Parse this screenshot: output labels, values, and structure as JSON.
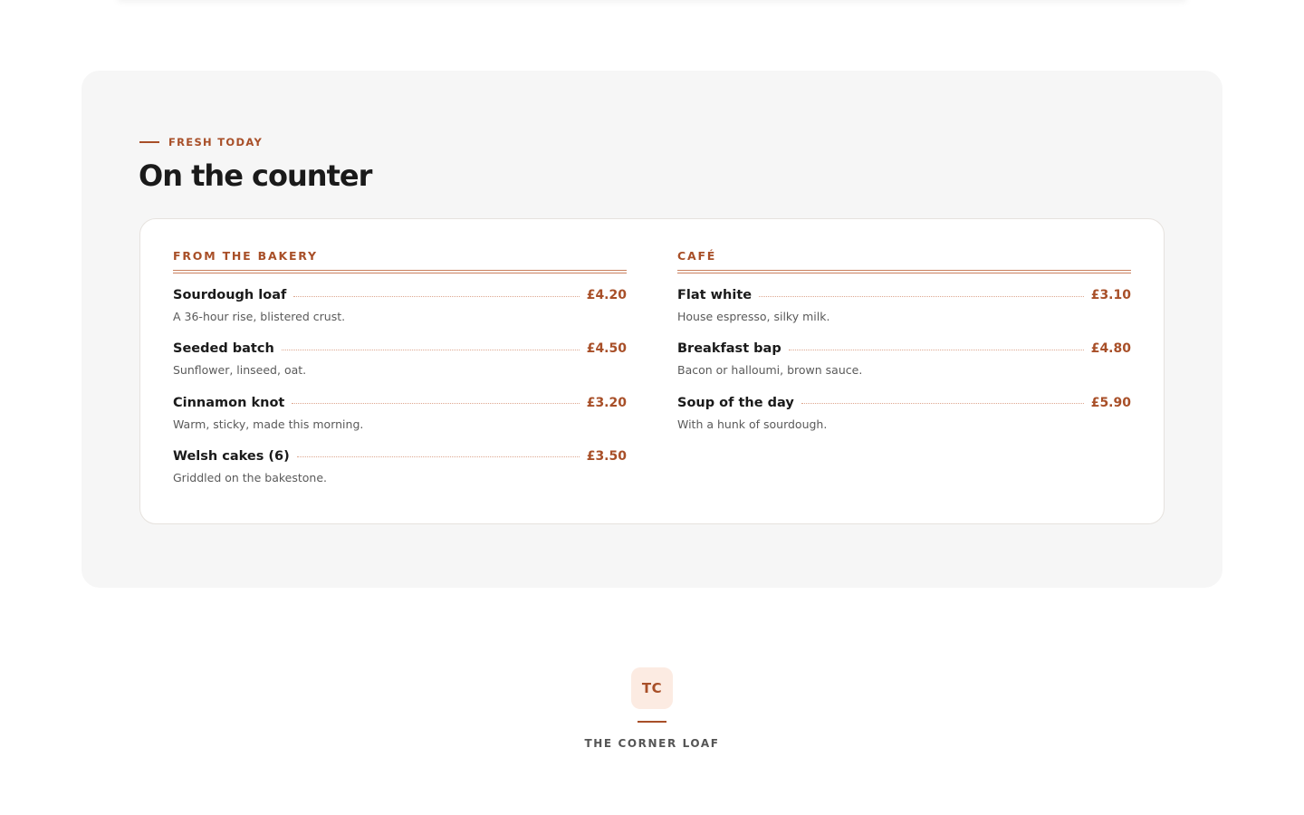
{
  "section": {
    "eyebrow": "FRESH TODAY",
    "title": "On the counter"
  },
  "bakery": {
    "heading": "FROM THE BAKERY",
    "items": [
      {
        "name": "Sourdough loaf",
        "price": "£4.20",
        "desc": "A 36-hour rise, blistered crust."
      },
      {
        "name": "Seeded batch",
        "price": "£4.50",
        "desc": "Sunflower, linseed, oat."
      },
      {
        "name": "Cinnamon knot",
        "price": "£3.20",
        "desc": "Warm, sticky, made this morning."
      },
      {
        "name": "Welsh cakes (6)",
        "price": "£3.50",
        "desc": "Griddled on the bakestone."
      }
    ]
  },
  "cafe": {
    "heading": "CAFÉ",
    "items": [
      {
        "name": "Flat white",
        "price": "£3.10",
        "desc": "House espresso, silky milk."
      },
      {
        "name": "Breakfast bap",
        "price": "£4.80",
        "desc": "Bacon or halloumi, brown sauce."
      },
      {
        "name": "Soup of the day",
        "price": "£5.90",
        "desc": "With a hunk of sourdough."
      }
    ]
  },
  "footer": {
    "badge": "TC",
    "name": "THE CORNER LOAF"
  },
  "colors": {
    "accent": "#a84f28",
    "section_bg": "#f6f6f6",
    "badge_bg": "#fcebe2"
  }
}
